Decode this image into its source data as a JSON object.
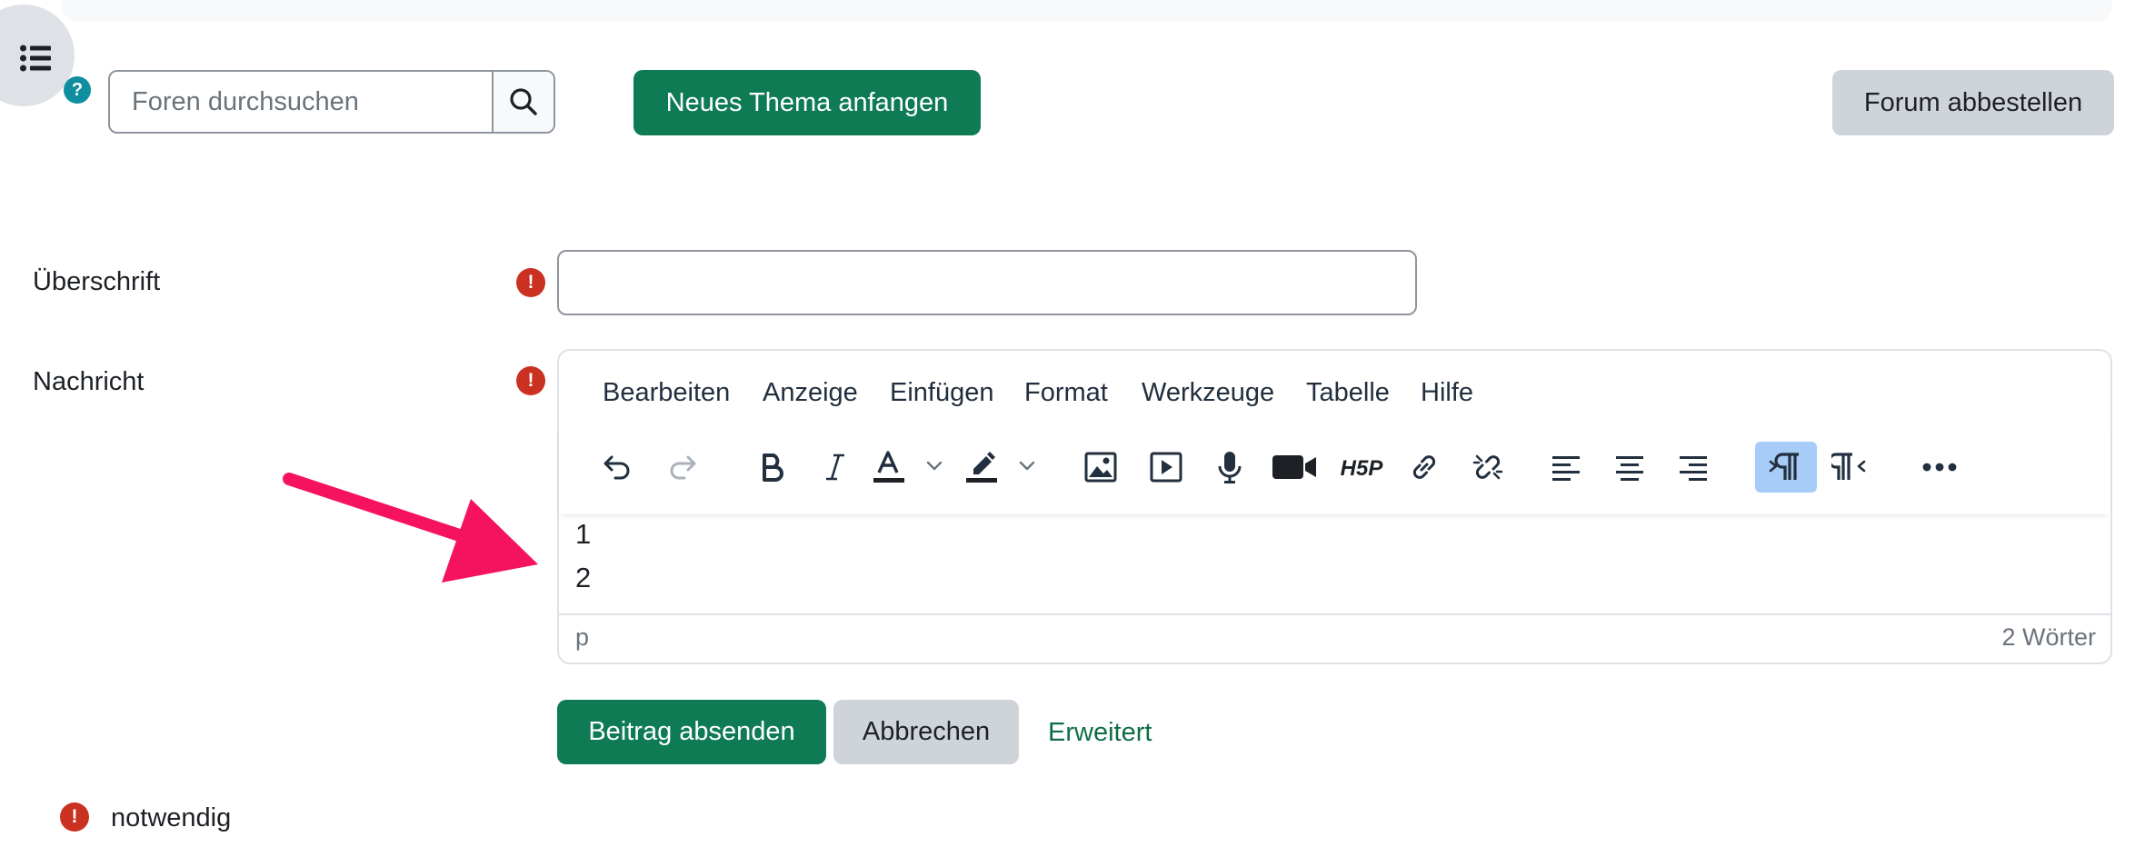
{
  "drawer": {
    "icon": "list-icon"
  },
  "search": {
    "placeholder": "Foren durchsuchen",
    "value": "",
    "icon": "search-icon"
  },
  "actions": {
    "help_icon": "?",
    "new_topic": "Neues Thema anfangen",
    "unsubscribe": "Forum abbestellen"
  },
  "form": {
    "subject_label": "Überschrift",
    "subject_value": "",
    "message_label": "Nachricht",
    "required_icon": "!"
  },
  "editor": {
    "menu": [
      "Bearbeiten",
      "Anzeige",
      "Einfügen",
      "Format",
      "Werkzeuge",
      "Tabelle",
      "Hilfe"
    ],
    "toolbar": [
      "undo-icon",
      "redo-icon",
      "bold-icon",
      "italic-icon",
      "text-color-icon",
      "highlight-color-icon",
      "image-icon",
      "media-icon",
      "record-audio-icon",
      "record-video-icon",
      "h5p-icon",
      "link-icon",
      "unlink-icon",
      "align-left-icon",
      "align-center-icon",
      "align-right-icon",
      "ltr-icon",
      "rtl-icon",
      "more-icon"
    ],
    "h5p_label": "H5P",
    "content_lines": [
      "1",
      "2"
    ],
    "status_path": "p",
    "word_count": "2 Wörter"
  },
  "buttons": {
    "submit": "Beitrag absenden",
    "cancel": "Abbrechen",
    "advanced": "Erweitert"
  },
  "required_note": "notwendig",
  "annotation": {
    "icon": "arrow-icon",
    "color": "#f5135f"
  },
  "colors": {
    "primary": "#0f7b54",
    "secondary": "#ced4da",
    "danger": "#ca3120",
    "info": "#0f8ea0",
    "active": "#a6ccf7"
  }
}
